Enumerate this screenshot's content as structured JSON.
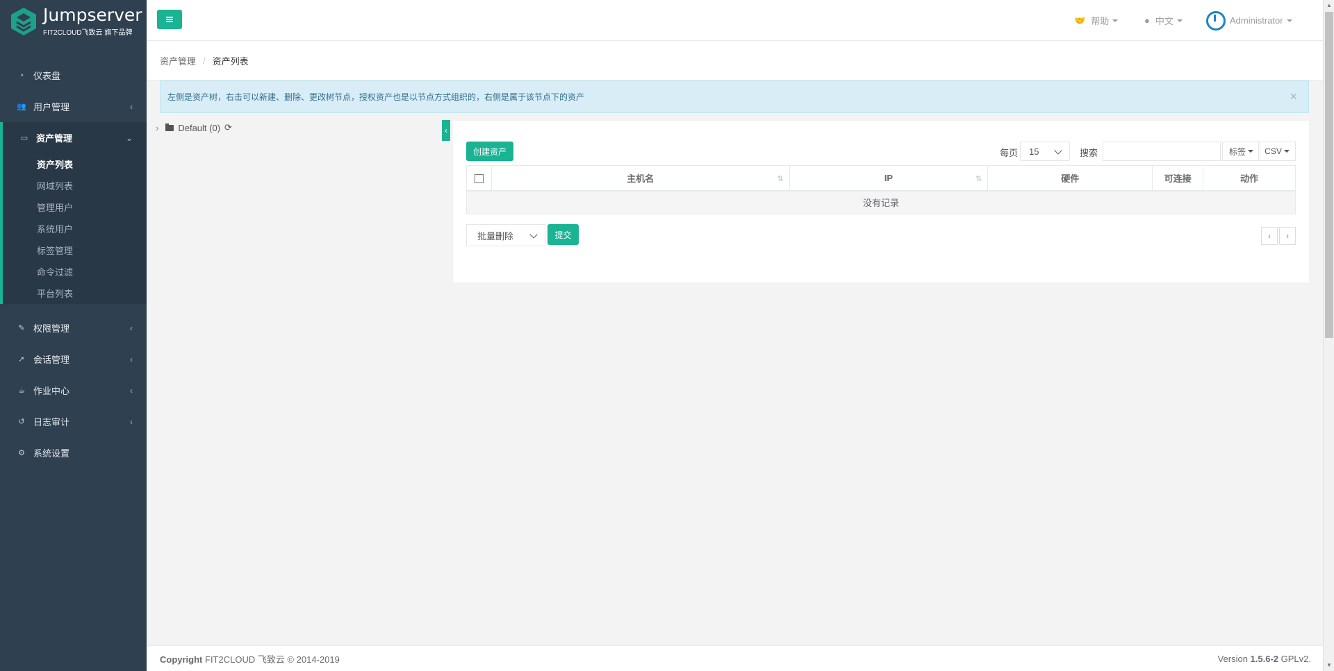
{
  "app": {
    "logo_title": "Jumpserver",
    "logo_sub": "FIT2CLOUD飞致云 旗下品牌",
    "accent": "#1ab394",
    "sidebar_bg": "#2f4050"
  },
  "sidebar": {
    "items": [
      {
        "label": "仪表盘",
        "icon": "dashboard-icon"
      },
      {
        "label": "用户管理",
        "icon": "users-icon"
      },
      {
        "label": "资产管理",
        "icon": "inbox-icon"
      },
      {
        "label": "权限管理",
        "icon": "edit-icon"
      },
      {
        "label": "会话管理",
        "icon": "rocket-icon"
      },
      {
        "label": "作业中心",
        "icon": "coffee-icon"
      },
      {
        "label": "日志审计",
        "icon": "history-icon"
      },
      {
        "label": "系统设置",
        "icon": "cogs-icon"
      }
    ],
    "asset_sub": [
      "资产列表",
      "网域列表",
      "管理用户",
      "系统用户",
      "标签管理",
      "命令过滤",
      "平台列表"
    ]
  },
  "topbar": {
    "help": "帮助",
    "lang": "中文",
    "user": "Administrator"
  },
  "breadcrumb": {
    "parent": "资产管理",
    "sep": "/",
    "current": "资产列表"
  },
  "alert": {
    "text": "左侧是资产树，右击可以新建、删除、更改树节点，授权资产也是以节点方式组织的，右侧是属于该节点下的资产",
    "close": "×"
  },
  "tree": {
    "node": "Default (0)"
  },
  "table": {
    "create_label": "创建资产",
    "perpage_label": "每页",
    "perpage_value": "15",
    "search_label": "搜索",
    "search_value": "",
    "tag_label": "标签",
    "csv_label": "CSV",
    "headers": [
      "主机名",
      "IP",
      "硬件",
      "可连接",
      "动作"
    ],
    "empty": "没有记录",
    "batch_label": "批量删除",
    "submit_label": "提交",
    "prev": "‹",
    "next": "›"
  },
  "footer": {
    "copyright_bold": "Copyright",
    "copyright_rest": " FIT2CLOUD 飞致云 © 2014-2019",
    "version_pre": "Version ",
    "version_num": "1.5.6-2",
    "version_post": " GPLv2."
  }
}
